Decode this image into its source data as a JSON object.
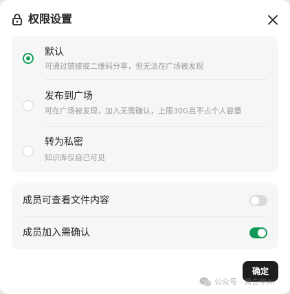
{
  "dialog": {
    "title": "权限设置",
    "confirm_label": "确定"
  },
  "options": [
    {
      "title": "默认",
      "desc": "可通过链接或二维码分享，但无法在广场被发现",
      "selected": true
    },
    {
      "title": "发布到广场",
      "desc": "可在广场被发现，加入无需确认，上限30G且不占个人容量",
      "selected": false
    },
    {
      "title": "转为私密",
      "desc": "知识库仅自己可见",
      "selected": false
    }
  ],
  "member_settings": [
    {
      "label": "成员可查看文件内容",
      "enabled": false
    },
    {
      "label": "成员加入需确认",
      "enabled": true
    }
  ],
  "colors": {
    "accent": "#0e9f5a",
    "toggle_on": "#119a57",
    "toggle_off": "#dadada",
    "card_bg": "#f6f6f7",
    "button_bg": "#1e1e1e"
  },
  "icons": [
    "lock-icon",
    "close-icon",
    "wechat-icon"
  ],
  "watermark": {
    "text": "公众号 · 黑白学AI"
  }
}
